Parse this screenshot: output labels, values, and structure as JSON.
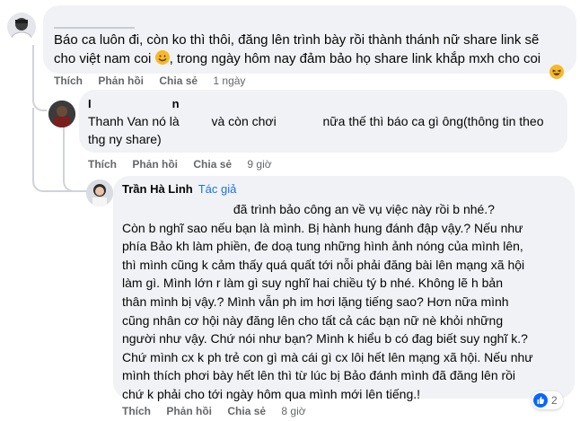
{
  "comment1": {
    "text_line1": "Báo ca luôn đi, còn ko thì thôi, đăng lên trình bày rồi thành thánh nữ share link sẽ",
    "text_line2a": "cho việt nam coi",
    "text_line2b": ", trong ngày hôm nay đảm bảo họ share link khắp mxh cho coi",
    "actions": {
      "like": "Thích",
      "reply": "Phản hồi",
      "share": "Chia sẻ",
      "time": "1 ngày"
    }
  },
  "comment2": {
    "name_start": "I",
    "name_end": "n",
    "text_line1a": "Thanh Van nó là",
    "text_line1b": "và còn chơi",
    "text_line1c": "nữa thế thì báo ca gì ông(thông tin theo",
    "text_line2": "thg ny share)",
    "actions": {
      "like": "Thích",
      "reply": "Phản hồi",
      "share": "Chia sẻ",
      "time": "9 giờ"
    }
  },
  "comment3": {
    "name": "Trần Hà Linh",
    "badge": "Tác giả",
    "lines": [
      "đã trình bảo công an về vụ việc này rồi b nhé.?",
      "Còn b nghĩ sao nếu bạn là mình. Bị hành hung đánh đập vậy.? Nếu như",
      "phía Bảo kh làm phiền, đe doạ tung những hình ảnh nóng của mình lên,",
      "thì mình cũng k cảm thấy quá quất tới nỗi phải đăng bài lên mạng xã hội",
      "làm gì. Mình lớn r làm gì suy nghĩ hai chiều tý b nhé. Không lẽ h bản",
      "thân mình bị vậy.? Mình vẫn ph im hơi lặng tiếng sao? Hơn nữa mình",
      "cũng nhân cơ hội này đăng lên cho tất cả các bạn nữ nè khỏi những",
      "người như vậy. Chứ nói như bạn? Mình k hiểu b có đag biết suy nghĩ k.?",
      "Chứ mình cx k ph trẻ con gì mà cái gì cx lôi hết lên mạng xã hội. Nếu như",
      "mình thích phơi bày hết lên thì từ lúc bị Bảo đánh mình đã đăng lên rồi",
      "chứ k phải cho tới ngày hôm qua mình mới lên tiếng.!"
    ],
    "reaction_count": "2",
    "actions": {
      "like": "Thích",
      "reply": "Phản hồi",
      "share": "Chia sẻ",
      "time": "8 giờ"
    }
  },
  "colors": {
    "bubble": "#f0f2f5",
    "meta": "#65676b",
    "link": "#1b74e4",
    "like": "#0866ff",
    "emoji": "#f7b928"
  },
  "icons": [
    "user-avatar",
    "laughing-emoji",
    "like-reaction-icon"
  ]
}
